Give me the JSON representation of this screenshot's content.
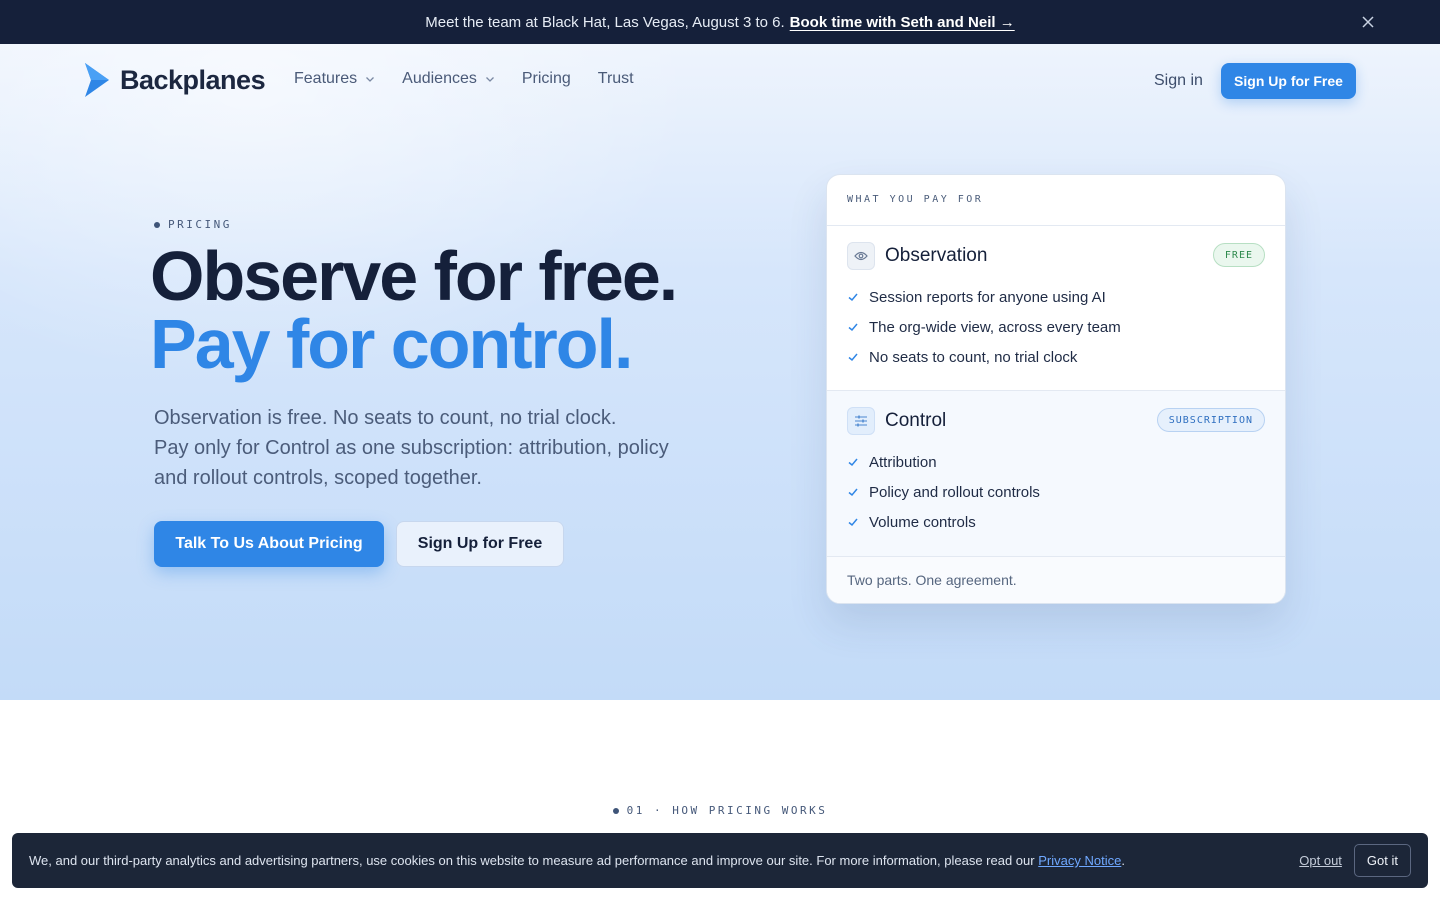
{
  "announcement": {
    "message": "Meet the team at Black Hat, Las Vegas, August 3 to 6.",
    "link_label": "Book time with Seth and Neil →",
    "close_icon": "close-icon"
  },
  "nav": {
    "brand": "Backplanes",
    "items": [
      {
        "label": "Features",
        "has_dropdown": true
      },
      {
        "label": "Audiences",
        "has_dropdown": true
      },
      {
        "label": "Pricing",
        "has_dropdown": false
      },
      {
        "label": "Trust",
        "has_dropdown": false
      }
    ],
    "sign_in": "Sign in",
    "sign_up": "Sign Up for Free"
  },
  "hero": {
    "eyebrow": "PRICING",
    "headline_line1": "Observe for free.",
    "headline_line2": "Pay for control.",
    "lead_line1": "Observation is free. No seats to count, no trial clock.",
    "lead_line2": "Pay only for Control as one subscription: attribution, policy",
    "lead_line3": "and rollout controls, scoped together.",
    "primary_cta": "Talk To Us About Pricing",
    "secondary_cta": "Sign Up for Free"
  },
  "pricing_card": {
    "header": "WHAT YOU PAY FOR",
    "observation": {
      "title": "Observation",
      "badge": "FREE",
      "icon": "eye-icon",
      "items": [
        "Session reports for anyone using AI",
        "The org-wide view, across every team",
        "No seats to count, no trial clock"
      ]
    },
    "control": {
      "title": "Control",
      "badge": "SUBSCRIPTION",
      "icon": "sliders-icon",
      "items": [
        "Attribution",
        "Policy and rollout controls",
        "Volume controls"
      ]
    },
    "footer": "Two parts. One agreement."
  },
  "next_section": {
    "label": "01 · HOW PRICING WORKS"
  },
  "cookie_banner": {
    "text": "We, and our third-party analytics and advertising partners, use cookies on this website to measure ad performance and improve our site. For more information, please read our",
    "link": "Privacy Notice",
    "period": ".",
    "opt_out": "Opt out",
    "got_it": "Got it"
  },
  "colors": {
    "accent": "#2f86e6",
    "navy": "#15203a",
    "free_green": "#2e8a4d"
  }
}
